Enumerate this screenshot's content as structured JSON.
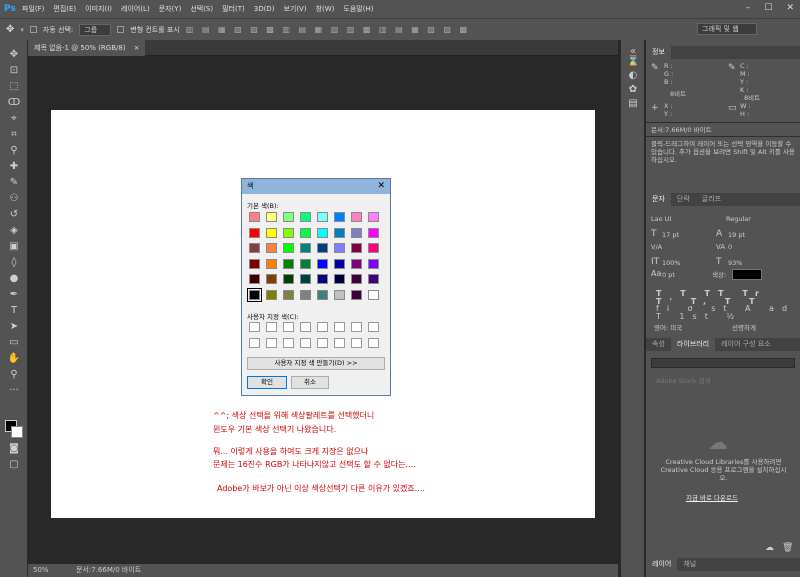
{
  "menubar": {
    "logo": "Ps",
    "items": [
      "파일(F)",
      "편집(E)",
      "이미지(I)",
      "레이어(L)",
      "문자(Y)",
      "선택(S)",
      "필터(T)",
      "3D(D)",
      "보기(V)",
      "창(W)",
      "도움말(H)"
    ]
  },
  "options": {
    "auto_select": "자동 선택:",
    "group": "그룹",
    "transform": "변형 컨트롤 표시",
    "workspace": "그래픽 및 웹"
  },
  "document": {
    "tab": "제목 없음-1 @ 50% (RGB/8)",
    "close": "×",
    "zoom": "50%",
    "status": "문서:7.66M/0 바이트"
  },
  "info_panel": {
    "tab": "정보",
    "r": "R :",
    "g": "G :",
    "b": "B :",
    "c": "C :",
    "m": "M :",
    "y": "Y :",
    "k": "K :",
    "bit1": "8비트",
    "bit2": "8비트",
    "x": "X :",
    "yc": "Y :",
    "w": "W :",
    "h": "H :",
    "doc": "문서:7.66M/0 바이트",
    "hint": "클릭-드래그하여 레이어 또는 선택 영역을 이동할 수 있습니다. 추가 옵션을 보려면 Shift 및 Alt 키를 사용하십시오."
  },
  "char_panel": {
    "tabs": [
      "문자",
      "단락",
      "글리프"
    ],
    "font": "Lao UI",
    "style": "Regular",
    "size": "17 pt",
    "leading": "19 pt",
    "kern": "V/A",
    "track": "0",
    "vscale": "100%",
    "hscale": "93%",
    "baseline": "0 pt",
    "color_label": "색상:",
    "lang": "영어: 미국",
    "aa": "선명하게"
  },
  "library_panel": {
    "tabs": [
      "속성",
      "라이브러리",
      "레이어 구성 요소"
    ],
    "search": "Adobe Stock 검색",
    "message": "Creative Cloud Libraries를 사용하려면 Creative Cloud 응용 프로그램을 설치하십시오.",
    "download": "지금 바로 다운로드"
  },
  "layers_panel": {
    "tabs": [
      "레이어",
      "채널"
    ]
  },
  "color_dialog": {
    "title": "색",
    "basic_label": "기본 색(B):",
    "custom_label": "사용자 지정 색(C):",
    "define_button": "사용자 지정 색 만들기(D) >>",
    "ok_button": "확인",
    "cancel_button": "취소",
    "basic_colors": [
      "#ff8080",
      "#ffff80",
      "#80ff80",
      "#00ff80",
      "#80ffff",
      "#0080ff",
      "#ff80c0",
      "#ff80ff",
      "#ff0000",
      "#ffff00",
      "#80ff00",
      "#00ff40",
      "#00ffff",
      "#0080c0",
      "#8080c0",
      "#ff00ff",
      "#804040",
      "#ff8040",
      "#00ff00",
      "#008080",
      "#004080",
      "#8080ff",
      "#800040",
      "#ff0080",
      "#800000",
      "#ff8000",
      "#008000",
      "#008040",
      "#0000ff",
      "#0000a0",
      "#800080",
      "#8000ff",
      "#400000",
      "#804000",
      "#004000",
      "#004040",
      "#000080",
      "#000040",
      "#400040",
      "#400080",
      "#000000",
      "#808000",
      "#808040",
      "#808080",
      "#408080",
      "#c0c0c0",
      "#400040",
      "#ffffff"
    ]
  },
  "notes": [
    "^^; 색상 선택을 위해 색상팔레트를 선택했더니",
    "윈도우 기본 색상 선택기 나왔습니다.",
    "뭐... 이렇게 사용을 하여도 크게 지장은 없으나",
    "문제는 16진수 RGB가 나타나지않고 선택도 할 수 없다는....",
    "Adobe가 바보가 아닌 이상 색상선택기 다른 이유가 있겠죠...."
  ]
}
